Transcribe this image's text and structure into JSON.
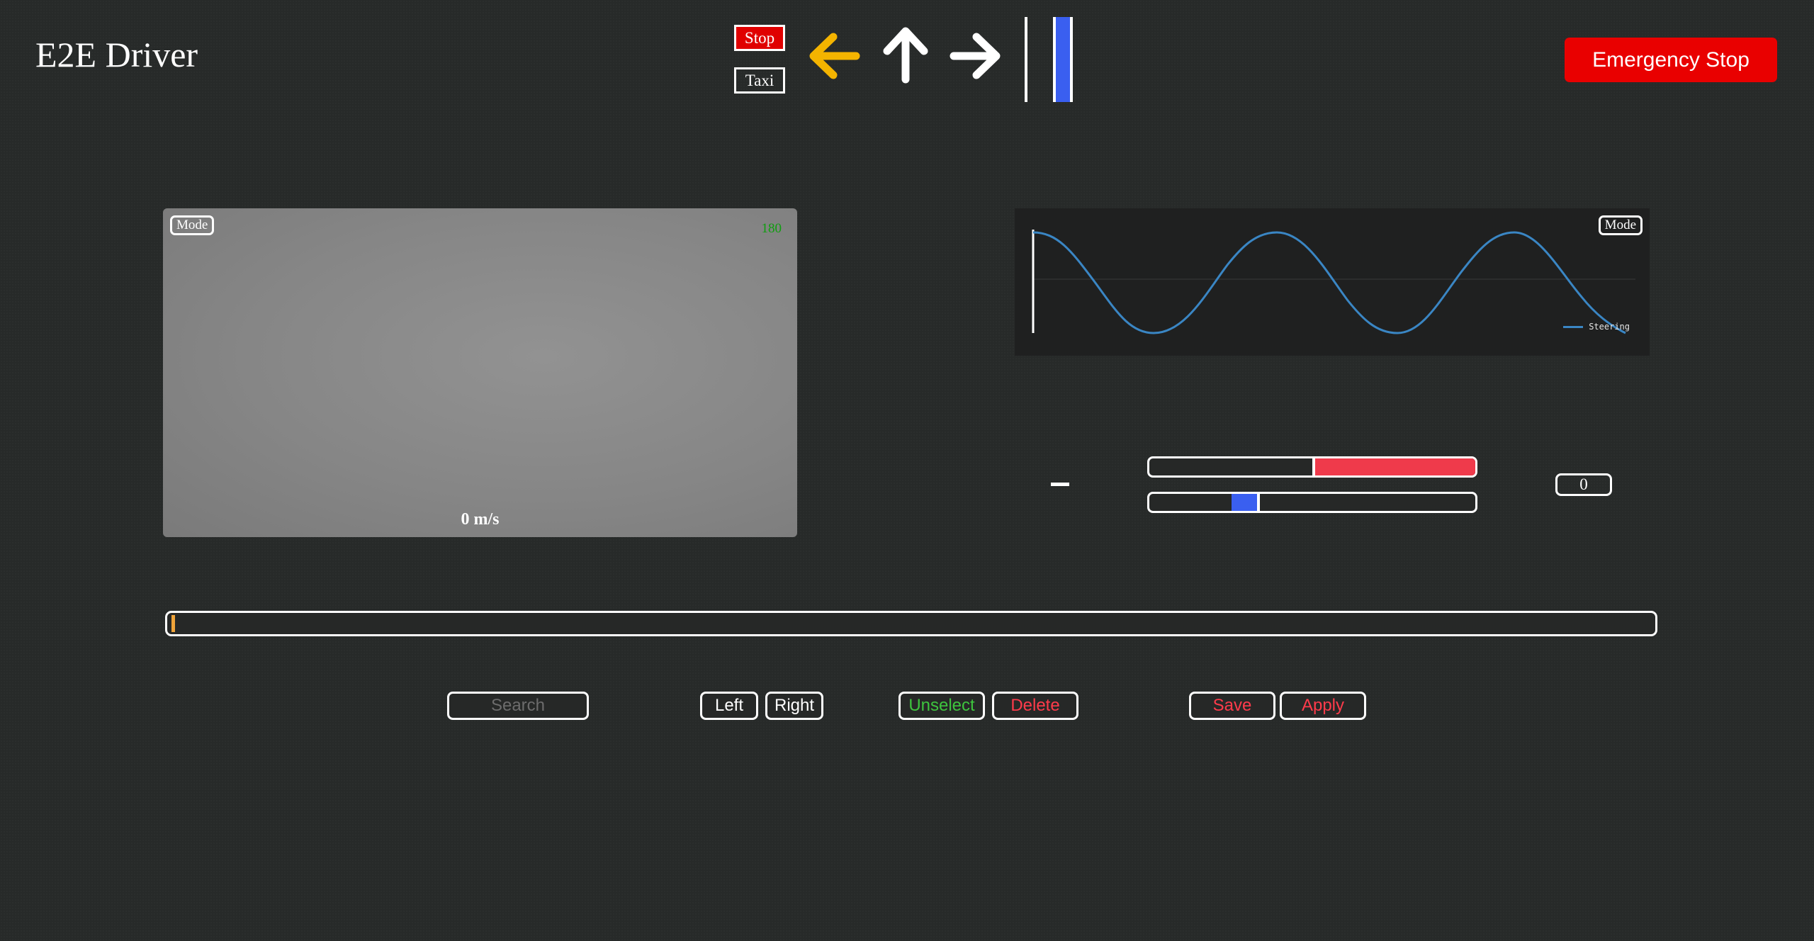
{
  "header": {
    "title": "E2E Driver",
    "mode_stop_label": "Stop",
    "mode_taxi_label": "Taxi",
    "emergency_label": "Emergency Stop",
    "arrows": [
      "arrow-left-icon",
      "arrow-up-icon",
      "arrow-right-icon"
    ],
    "active_arrow": "left"
  },
  "camera": {
    "mode_label": "Mode",
    "fps": "180",
    "speed": "0 m/s"
  },
  "graph": {
    "mode_label": "Mode",
    "legend_label": "Steering"
  },
  "controls": {
    "value": "0",
    "bar1_fill_from": 0.5,
    "bar2_fill_to": 0.34
  },
  "bottom": {
    "search_placeholder": "Search",
    "left_label": "Left",
    "right_label": "Right",
    "unselect_label": "Unselect",
    "delete_label": "Delete",
    "save_label": "Save",
    "apply_label": "Apply"
  },
  "colors": {
    "accent_yellow": "#f4b400",
    "emergency_red": "#e90000",
    "line_blue": "#3a86c4",
    "bar_red": "#ef3a4b",
    "bar_blue": "#3a5ff0"
  }
}
